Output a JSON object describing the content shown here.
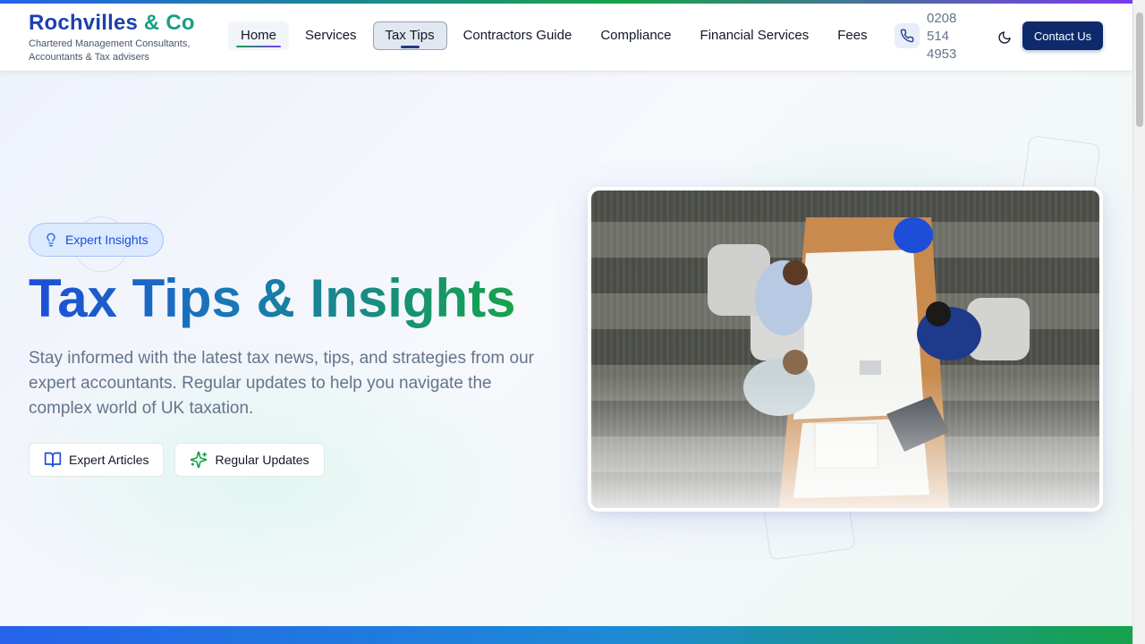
{
  "header": {
    "brand_name_part1": "Rochvilles",
    "brand_name_part2": "& Co",
    "brand_subtitle": "Chartered Management Consultants, Accountants & Tax advisers",
    "nav": [
      {
        "label": "Home"
      },
      {
        "label": "Services"
      },
      {
        "label": "Tax Tips"
      },
      {
        "label": "Contractors Guide"
      },
      {
        "label": "Compliance"
      },
      {
        "label": "Financial Services"
      },
      {
        "label": "Fees"
      }
    ],
    "active_nav": "Tax Tips",
    "phone": "0208 514 4953",
    "phone_icon": "phone-icon",
    "theme_icon": "moon-icon",
    "contact_label": "Contact Us"
  },
  "hero": {
    "badge_label": "Expert Insights",
    "badge_icon": "lightbulb-icon",
    "title": "Tax Tips & Insights",
    "description": "Stay informed with the latest tax news, tips, and strategies from our expert accountants. Regular updates to help you navigate the complex world of UK taxation.",
    "chips": [
      {
        "label": "Expert Articles",
        "icon": "book-open-icon"
      },
      {
        "label": "Regular Updates",
        "icon": "sparkles-icon"
      }
    ]
  },
  "colors": {
    "brand_blue": "#1e40af",
    "brand_green": "#16a085",
    "contact_button": "#0f2a6b",
    "accent_gradient_start": "#2563eb",
    "accent_gradient_end": "#16a34a"
  }
}
